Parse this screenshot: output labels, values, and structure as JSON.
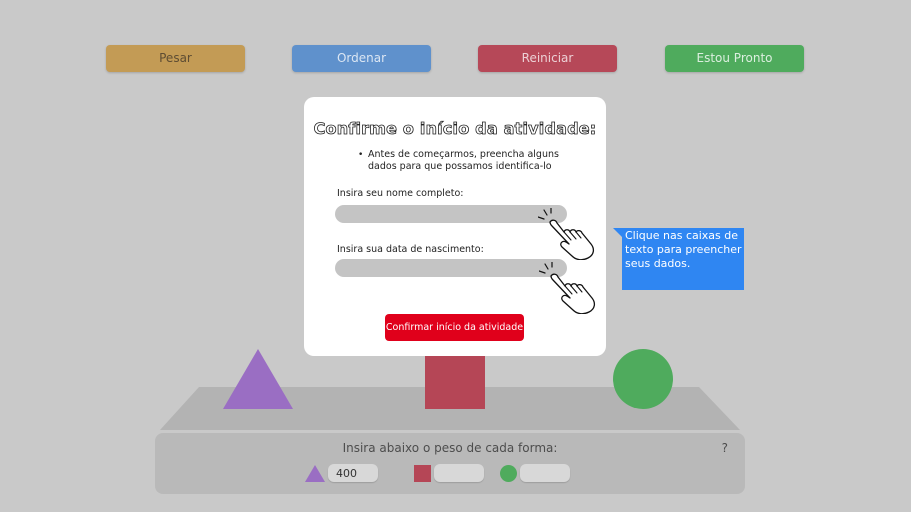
{
  "toolbar": {
    "pesar": "Pesar",
    "ordenar": "Ordenar",
    "reiniciar": "Reiniciar",
    "pronto": "Estou Pronto"
  },
  "modal": {
    "title": "Confirme o início da atividade:",
    "bullet": "Antes de começarmos, preencha alguns dados para que possamos identifica-lo",
    "name_label": "Insira seu nome completo:",
    "name_value": "",
    "birth_label": "Insira sua data de nascimento:",
    "birth_value": "",
    "confirm_label": "Confirmar início da atividade"
  },
  "tooltip": {
    "text": "Clique nas caixas de texto para preencher seus dados."
  },
  "weights": {
    "title": "Insira abaixo o peso de cada forma:",
    "help": "?",
    "triangle_value": "400",
    "square_value": "",
    "circle_value": ""
  },
  "icons": [
    "hand-pointer-icon",
    "triangle-shape",
    "square-shape",
    "circle-shape"
  ],
  "colors": {
    "pesar": "#c39b55",
    "ordenar": "#5f91cc",
    "reiniciar": "#b64858",
    "pronto": "#4fab5d",
    "confirm": "#e0001b",
    "tooltip": "#2f86f2",
    "triangle": "#9a6ec3",
    "square": "#b54656",
    "circle": "#4fab5d"
  }
}
